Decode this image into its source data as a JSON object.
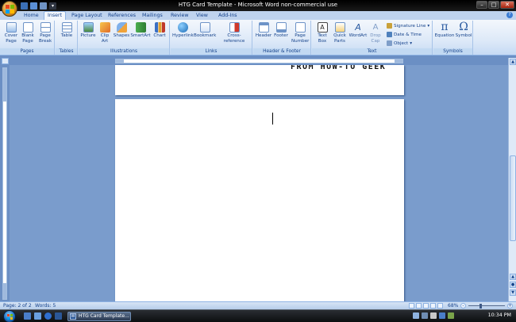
{
  "window": {
    "title": "HTG Card Template - Microsoft Word non-commercial use"
  },
  "tabs": [
    {
      "label": "Home",
      "active": false
    },
    {
      "label": "Insert",
      "active": true
    },
    {
      "label": "Page Layout",
      "active": false
    },
    {
      "label": "References",
      "active": false
    },
    {
      "label": "Mailings",
      "active": false
    },
    {
      "label": "Review",
      "active": false
    },
    {
      "label": "View",
      "active": false
    },
    {
      "label": "Add-Ins",
      "active": false
    }
  ],
  "ribbon": {
    "groups": {
      "pages": "Pages",
      "tables": "Tables",
      "illustrations": "Illustrations",
      "links": "Links",
      "header_footer": "Header & Footer",
      "text": "Text",
      "symbols": "Symbols"
    },
    "buttons": {
      "cover_page": [
        "Cover",
        "Page"
      ],
      "blank_page": [
        "Blank",
        "Page"
      ],
      "page_break": [
        "Page",
        "Break"
      ],
      "table": [
        "Table",
        ""
      ],
      "picture": [
        "Picture",
        ""
      ],
      "clip_art": [
        "Clip",
        "Art"
      ],
      "shapes": [
        "Shapes",
        ""
      ],
      "smartart": [
        "SmartArt",
        ""
      ],
      "chart": [
        "Chart",
        ""
      ],
      "hyperlink": [
        "Hyperlink",
        ""
      ],
      "bookmark": [
        "Bookmark",
        ""
      ],
      "cross_reference": [
        "Cross-reference",
        ""
      ],
      "header": [
        "Header",
        ""
      ],
      "footer": [
        "Footer",
        ""
      ],
      "page_number": [
        "Page",
        "Number"
      ],
      "text_box": [
        "Text",
        "Box"
      ],
      "quick_parts": [
        "Quick",
        "Parts"
      ],
      "wordart": [
        "WordArt",
        ""
      ],
      "drop_cap": [
        "Drop",
        "Cap"
      ],
      "equation": [
        "Equation",
        ""
      ],
      "symbol": [
        "Symbol",
        ""
      ]
    },
    "small_buttons": {
      "signature_line": "Signature Line",
      "date_time": "Date & Time",
      "object": "Object"
    }
  },
  "document": {
    "page1_text": "FROM HOW-TO GEEK"
  },
  "status": {
    "page": "Page: 2 of 2",
    "words": "Words: 5",
    "zoom": "68%"
  },
  "taskbar": {
    "task_label": "HTG Card Template...",
    "clock": "10:34 PM"
  },
  "colors": {
    "ribbon_text": "#15428b",
    "active_tab_bg": "#f3f7fc",
    "doc_background": "#7a9ccc"
  }
}
